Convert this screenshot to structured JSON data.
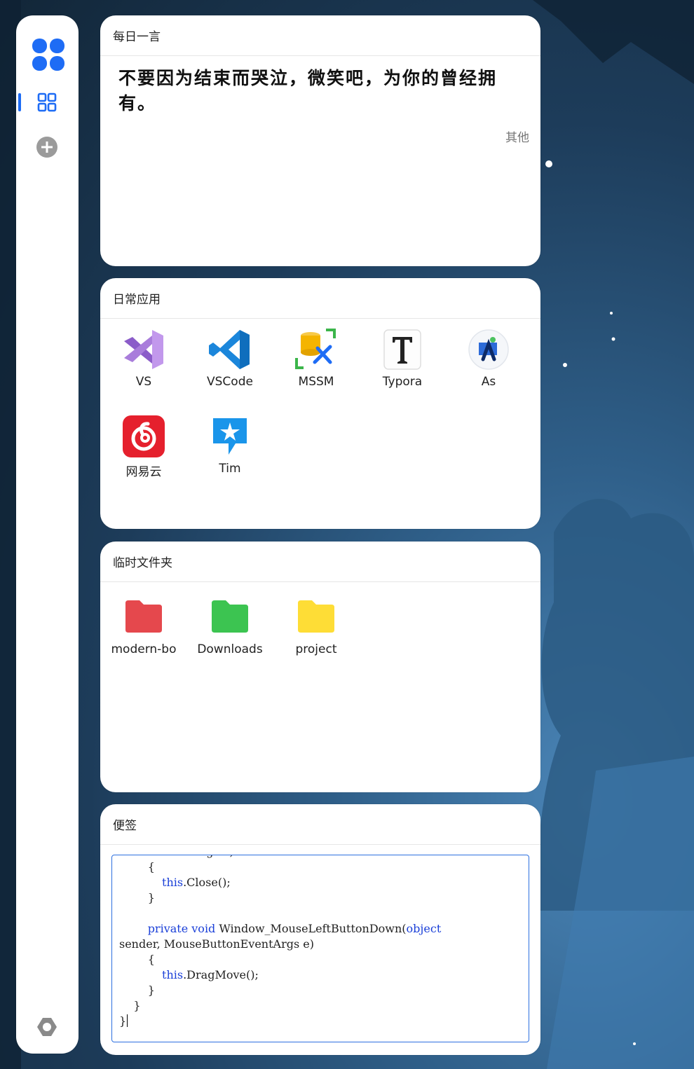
{
  "cards": {
    "quote": {
      "title": "每日一言",
      "text": "不要因为结束而哭泣，微笑吧，为你的曾经拥有。",
      "source": "其他"
    },
    "apps": {
      "title": "日常应用",
      "items": [
        {
          "label": "VS",
          "icon": "visual-studio-icon"
        },
        {
          "label": "VSCode",
          "icon": "vscode-icon"
        },
        {
          "label": "MSSM",
          "icon": "mssm-icon"
        },
        {
          "label": "Typora",
          "icon": "typora-icon"
        },
        {
          "label": "As",
          "icon": "android-studio-icon"
        },
        {
          "label": "网易云",
          "icon": "netease-music-icon"
        },
        {
          "label": "Tim",
          "icon": "tim-icon"
        }
      ]
    },
    "folders": {
      "title": "临时文件夹",
      "items": [
        {
          "label": "modern-bo",
          "color": "#e5484d"
        },
        {
          "label": "Downloads",
          "color": "#3cc451"
        },
        {
          "label": "project",
          "color": "#fedd36"
        }
      ]
    },
    "note": {
      "title": "便签",
      "lines": [
        [
          {
            "t": "RoutedEventArgs e)"
          }
        ],
        [
          {
            "t": "        {"
          }
        ],
        [
          {
            "t": "            "
          },
          {
            "t": "this",
            "k": 1
          },
          {
            "t": ".Close();"
          }
        ],
        [
          {
            "t": "        }"
          }
        ],
        [
          {
            "t": ""
          }
        ],
        [
          {
            "t": "        "
          },
          {
            "t": "private",
            "k": 1
          },
          {
            "t": " "
          },
          {
            "t": "void",
            "k": 1
          },
          {
            "t": " Window_MouseLeftButtonDown("
          },
          {
            "t": "object",
            "k": 1
          }
        ],
        [
          {
            "t": "sender, MouseButtonEventArgs e)"
          }
        ],
        [
          {
            "t": "        {"
          }
        ],
        [
          {
            "t": "            "
          },
          {
            "t": "this",
            "k": 1
          },
          {
            "t": ".DragMove();"
          }
        ],
        [
          {
            "t": "        }"
          }
        ],
        [
          {
            "t": "    }"
          }
        ],
        [
          {
            "t": "}"
          }
        ]
      ]
    }
  },
  "colors": {
    "accent": "#1e6cf5"
  }
}
